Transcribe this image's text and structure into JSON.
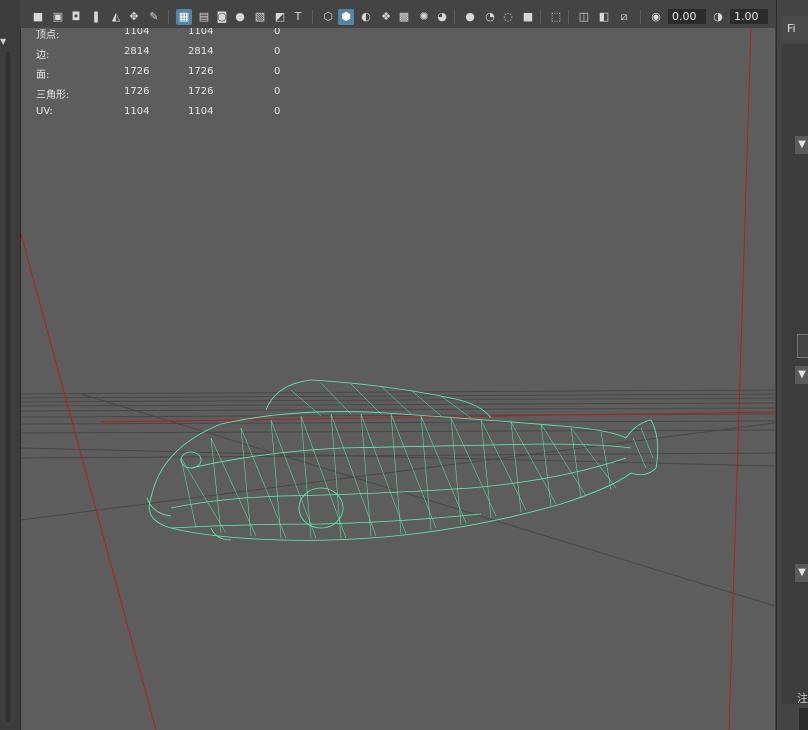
{
  "toolbar": {
    "exposure_value": "0.00",
    "gamma_value": "1.00",
    "icons": [
      "camera-select-icon",
      "camera-attributes-icon",
      "bookmark-icon",
      "image-plane-icon",
      "camera-pan-icon",
      "grease-pencil-icon",
      "grid-icon",
      "film-gate-icon",
      "resolution-gate-icon",
      "gate-mask-icon",
      "field-chart-icon",
      "safe-action-icon",
      "safe-title-icon",
      "wireframe-icon",
      "smooth-shade-icon",
      "wireframe-on-shaded-icon",
      "default-material-icon",
      "textured-icon",
      "use-all-lights-icon",
      "shadows-icon",
      "screen-space-ao-icon",
      "motion-blur-icon",
      "anti-aliasing-icon",
      "depth-of-field-icon",
      "isolate-select-icon",
      "xray-icon",
      "xray-joints-icon",
      "xray-active-icon",
      "backface-culling-icon",
      "exposure-icon",
      "gamma-icon"
    ]
  },
  "hud": {
    "rows": [
      {
        "label": "顶点:",
        "a": "1104",
        "b": "1104",
        "c": "0"
      },
      {
        "label": "边:",
        "a": "2814",
        "b": "2814",
        "c": "0"
      },
      {
        "label": "面:",
        "a": "1726",
        "b": "1726",
        "c": "0"
      },
      {
        "label": "三角形:",
        "a": "1726",
        "b": "1726",
        "c": "0"
      },
      {
        "label": "UV:",
        "a": "1104",
        "b": "1104",
        "c": "0"
      }
    ]
  },
  "right_panel": {
    "tab_label": "Fi",
    "bottom_label": "注"
  },
  "colors": {
    "wireframe": "#5ef0b4",
    "axis_red": "#b02020",
    "viewport_bg": "#5d5d5d",
    "active_button": "#5285a6"
  }
}
